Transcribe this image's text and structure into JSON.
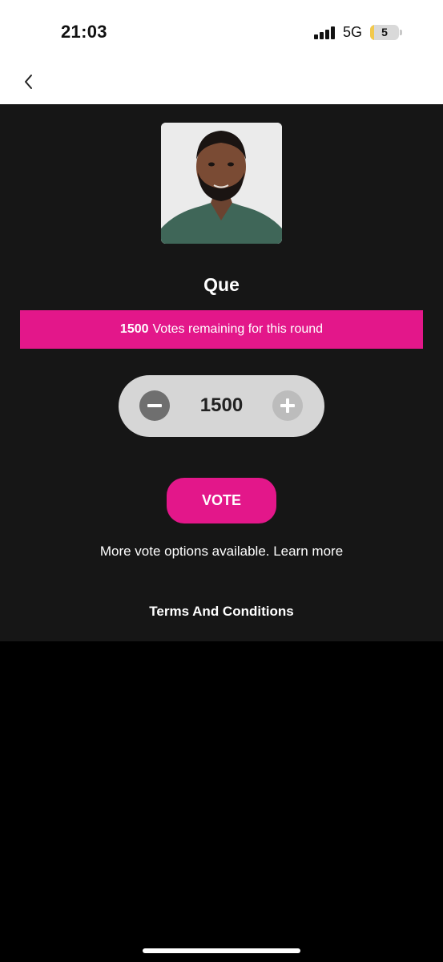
{
  "status_bar": {
    "time": "21:03",
    "network": "5G",
    "battery_level": "5",
    "signal_icon": "cellular-signal-icon",
    "battery_icon": "battery-icon",
    "battery_color": "#f2c94c"
  },
  "nav": {
    "back_icon": "chevron-left-icon"
  },
  "contestant": {
    "name": "Que",
    "avatar": "contestant-portrait"
  },
  "votes_banner": {
    "count": "1500",
    "text": "Votes remaining for this round"
  },
  "stepper": {
    "value": "1500",
    "minus_icon": "minus-icon",
    "plus_icon": "plus-icon"
  },
  "vote_button": {
    "label": "VOTE"
  },
  "more_options_text": "More vote options available. Learn more",
  "terms_label": "Terms And Conditions",
  "colors": {
    "accent": "#e3178a",
    "background": "#161616",
    "page_background": "#000000"
  }
}
